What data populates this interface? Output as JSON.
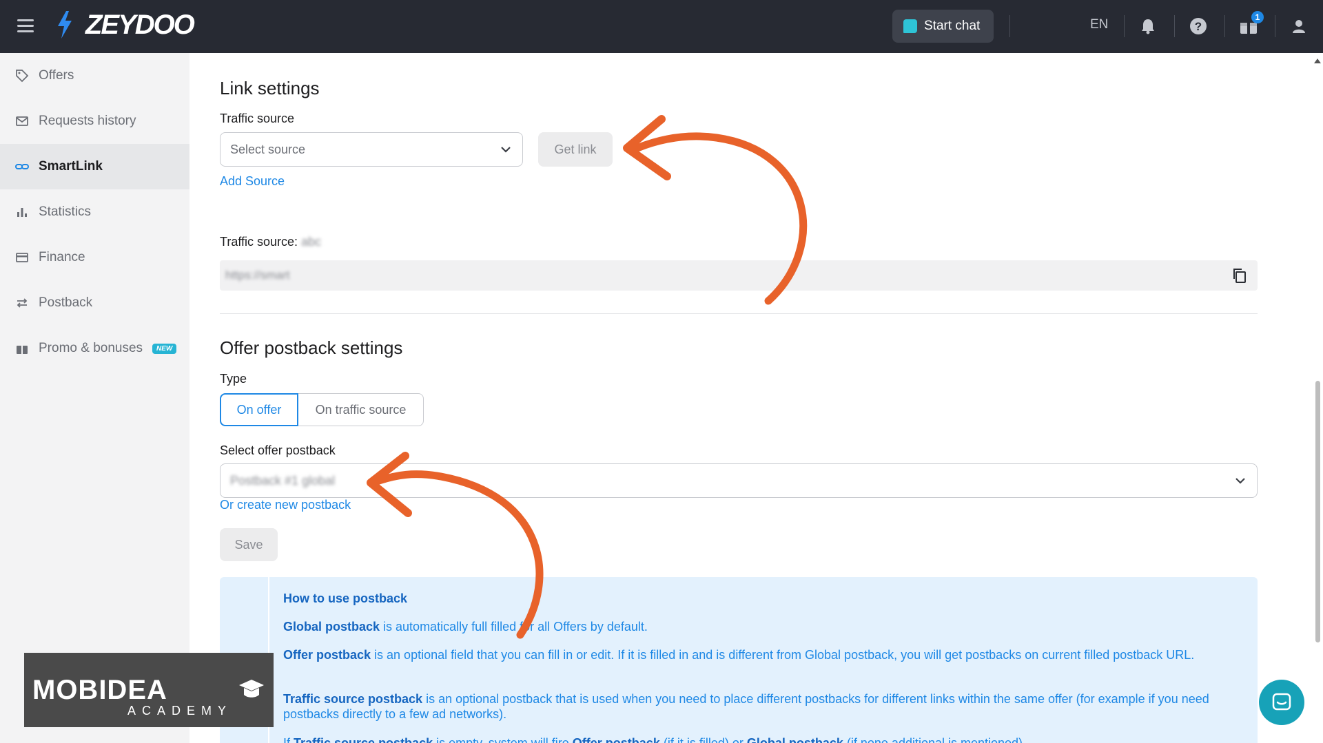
{
  "header": {
    "logo": "ZEYDOO",
    "start_chat": "Start chat",
    "language": "EN",
    "gift_badge": "1",
    "icons": [
      "menu-icon",
      "bell-icon",
      "help-icon",
      "gift-icon",
      "user-icon"
    ]
  },
  "sidebar": {
    "items": [
      {
        "label": "Offers",
        "icon": "tag-icon"
      },
      {
        "label": "Requests history",
        "icon": "mail-icon"
      },
      {
        "label": "SmartLink",
        "icon": "link-icon",
        "active": true
      },
      {
        "label": "Statistics",
        "icon": "bar-chart-icon"
      },
      {
        "label": "Finance",
        "icon": "card-icon"
      },
      {
        "label": "Postback",
        "icon": "swap-icon"
      },
      {
        "label": "Promo & bonuses",
        "icon": "gift-icon",
        "badge": "NEW"
      }
    ]
  },
  "link_settings": {
    "title": "Link settings",
    "traffic_source_label": "Traffic source",
    "select_placeholder": "Select source",
    "get_link": "Get link",
    "add_source": "Add Source",
    "traffic_source_prefix": "Traffic source:",
    "traffic_source_value": "abc",
    "link_value": "https://smart"
  },
  "postback_settings": {
    "title": "Offer postback settings",
    "type_label": "Type",
    "type_options": [
      "On offer",
      "On traffic source"
    ],
    "selected_type": "On offer",
    "select_label": "Select offer postback",
    "select_value": "Postback #1 global",
    "create_new": "Or create new postback",
    "save": "Save"
  },
  "info": {
    "title": "How to use postback",
    "p1_bold": "Global postback",
    "p1_rest": " is automatically full filled for all Offers by default.",
    "p2_bold": "Offer postback",
    "p2_rest": " is an optional field that you can fill in or edit. If it is filled in and is different from Global postback, you will get postbacks on current filled postback URL.",
    "p3_bold": "Traffic source postback",
    "p3_rest": " is an optional postback that is used when you need to place different postbacks for different links within the same offer (for example if you need postbacks directly to a few ad networks).",
    "p4_a": "If ",
    "p4_b1": "Traffic source postback",
    "p4_c": " is empty, system will fire ",
    "p4_b2": "Offer postback",
    "p4_d": " (if it is filled) or ",
    "p4_b3": "Global postback",
    "p4_e": " (if none additional is mentioned)."
  },
  "watermark": {
    "main": "MOBIDEA",
    "sub": "ACADEMY"
  },
  "colors": {
    "topbar": "#272a33",
    "accent": "#1e88e5",
    "arrow": "#e8622a",
    "sidebar": "#f3f3f4",
    "info_bg": "#e3f1fd"
  }
}
